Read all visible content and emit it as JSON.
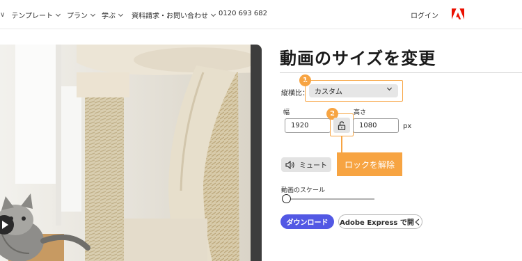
{
  "nav": {
    "items": [
      {
        "label": "テンプレート"
      },
      {
        "label": "プラン"
      },
      {
        "label": "学ぶ"
      },
      {
        "label": "資料請求・お問い合わせ"
      }
    ],
    "phone": "0120 693 682",
    "login": "ログイン",
    "logo_icon": "adobe-logo"
  },
  "panel": {
    "title": "動画のサイズを変更",
    "aspect_label": "縦横比：",
    "aspect_value": "カスタム",
    "width_label": "幅",
    "height_label": "高さ",
    "width_value": "1920",
    "height_value": "1080",
    "unit": "px",
    "lock_icon": "unlock-icon",
    "unlock_callout": "ロックを解除",
    "mute_label": "ミュート",
    "scale_label": "動画のスケール",
    "scale_value": 0,
    "download_label": "ダウンロード",
    "open_express_label": "Adobe Express で開く"
  },
  "callouts": {
    "badge1": "1",
    "badge2": "2",
    "accent_color": "#f7a442"
  },
  "colors": {
    "download_button": "#5258e4",
    "adobe_red": "#eb1000"
  }
}
